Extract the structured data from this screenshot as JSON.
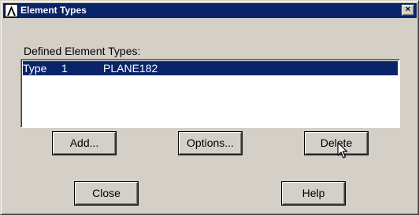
{
  "window": {
    "title": "Element Types",
    "close_glyph": "×"
  },
  "list": {
    "label": "Defined Element Types:",
    "rows": [
      {
        "type_label": "Type",
        "number": "1",
        "element": "PLANE182",
        "selected": true
      }
    ]
  },
  "buttons": {
    "add": "Add...",
    "options": "Options...",
    "delete": "Delete",
    "close": "Close",
    "help": "Help"
  },
  "colors": {
    "titlebar": "#0a246a",
    "selection": "#0a246a",
    "face": "#d4d0c8"
  },
  "icons": {
    "app": "ansys-logo-icon",
    "cursor": "mouse-pointer-icon"
  }
}
